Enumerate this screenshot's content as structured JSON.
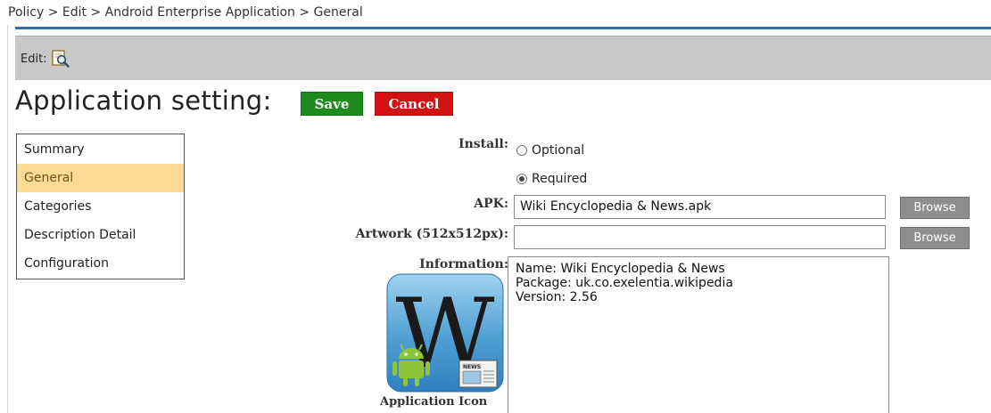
{
  "breadcrumb": "Policy > Edit > Android Enterprise Application > General",
  "toolbar": {
    "label": "Edit:",
    "icon": "edit-search-icon"
  },
  "page": {
    "title": "Application setting:",
    "save_label": "Save",
    "cancel_label": "Cancel",
    "save_color": "#1f8b1f",
    "cancel_color": "#d11212"
  },
  "nav": {
    "items": [
      {
        "label": "Summary",
        "active": false
      },
      {
        "label": "General",
        "active": true
      },
      {
        "label": "Categories",
        "active": false
      },
      {
        "label": "Description Detail",
        "active": false
      },
      {
        "label": "Configuration",
        "active": false
      }
    ]
  },
  "form": {
    "install_label": "Install:",
    "install_options": [
      "Optional",
      "Required"
    ],
    "install_selected": "Required",
    "apk_label": "APK:",
    "apk_value": "Wiki Encyclopedia & News.apk",
    "artwork_label": "Artwork (512x512px):",
    "artwork_value": "",
    "browse_label": "Browse",
    "information_label": "Information:",
    "information_lines": [
      "Name: Wiki Encyclopedia & News",
      "Package: uk.co.exelentia.wikipedia",
      "Version: 2.56"
    ],
    "app_icon_caption": "Application Icon",
    "app_icon_letter": "W",
    "app_icon_badge": "NEWS"
  },
  "colors": {
    "nav_active_bg": "#fcdc93",
    "toolbar_bg": "#c8c8c8",
    "accent_rule": "#2f6fb0",
    "browse_bg": "#8e8e8e"
  }
}
